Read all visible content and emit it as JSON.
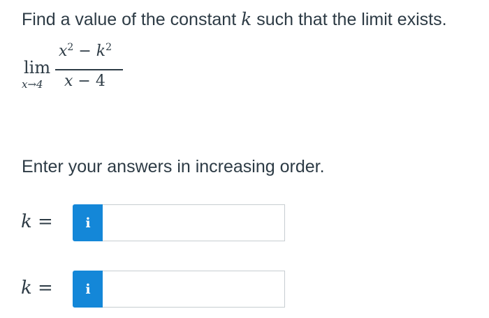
{
  "question": {
    "prompt_before_var": "Find a value of the constant ",
    "prompt_var": "k",
    "prompt_after_var": " such that the limit exists."
  },
  "expression": {
    "lim_word": "lim",
    "lim_subscript": "x→4",
    "numerator": {
      "x": "x",
      "x_exp": "2",
      "op": " − ",
      "k": "k",
      "k_exp": "2"
    },
    "denominator": {
      "x": "x",
      "rest": " − 4"
    }
  },
  "instruction": "Enter your answers in increasing order.",
  "answers": [
    {
      "var": "k",
      "eq": " = ",
      "info_icon_glyph": "i",
      "value": ""
    },
    {
      "var": "k",
      "eq": " = ",
      "info_icon_glyph": "i",
      "value": ""
    }
  ],
  "colors": {
    "info_button": "#1487d8",
    "text": "#2d3b45",
    "input_border": "#c7cdd1"
  },
  "icons": {
    "info": "info-icon"
  }
}
